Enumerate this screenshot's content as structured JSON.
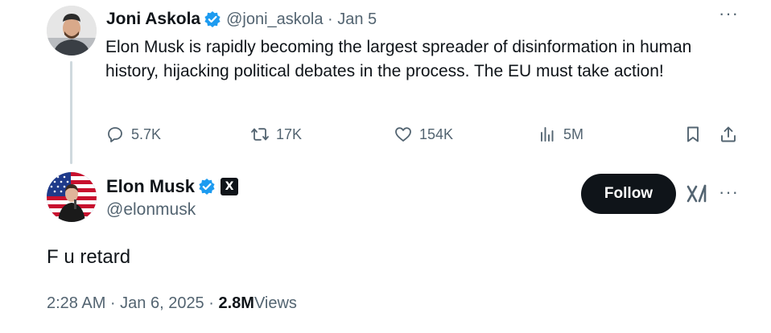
{
  "parent_tweet": {
    "author_name": "Joni Askola",
    "handle_time": "@joni_askola · Jan 5",
    "text": "Elon Musk is rapidly becoming the largest spreader of disinformation in human history, hijacking political debates in the process. The EU must take action!",
    "replies": "5.7K",
    "reposts": "17K",
    "likes": "154K",
    "views": "5M",
    "more_label": "···"
  },
  "reply_tweet": {
    "author_name": "Elon Musk",
    "handle": "@elonmusk",
    "affiliate_badge": "X",
    "follow_label": "Follow",
    "more_label": "···",
    "text": "F u retard",
    "timestamp": "2:28 AM · Jan 6, 2025 · ",
    "views_count": "2.8M",
    "views_label": " Views"
  },
  "colors": {
    "text_primary": "#0f1419",
    "text_secondary": "#536471",
    "verified_blue": "#1d9bf0",
    "thread_line": "#cfd9de",
    "button_dark": "#0f1419"
  },
  "icons": [
    "verified-badge-icon",
    "reply-icon",
    "repost-icon",
    "like-icon",
    "views-icon",
    "bookmark-icon",
    "share-icon",
    "grok-icon",
    "more-icon"
  ]
}
